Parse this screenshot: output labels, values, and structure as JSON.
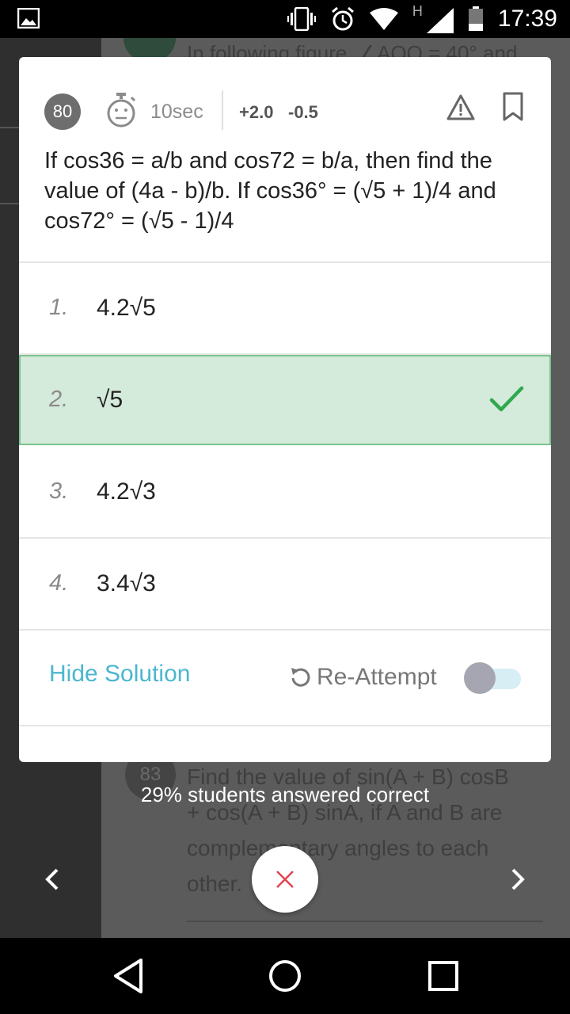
{
  "status_bar": {
    "time": "17:39",
    "network_type": "H",
    "icons": [
      "gallery-icon",
      "vibrate-icon",
      "alarm-icon",
      "wifi-icon",
      "signal-icon",
      "battery-icon"
    ]
  },
  "background": {
    "top_question_partial": "In following figure, ∠AOQ = 40° and",
    "next_question_number": "83",
    "next_question_text": "Find the value of sin(A + B) cosB + cos(A + B) sinA, if A and B are complementary angles to each other."
  },
  "question": {
    "number": "80",
    "timer": "10sec",
    "positive_marks": "+2.0",
    "negative_marks": "-0.5",
    "text": "If cos36 = a/b and cos72 = b/a, then find the value of (4a - b)/b. If cos36° = (√5 + 1)/4 and cos72° = (√5 - 1)/4"
  },
  "options": [
    {
      "num": "1.",
      "text": "4.2√5",
      "state": "normal"
    },
    {
      "num": "2.",
      "text": "√5",
      "state": "correct"
    },
    {
      "num": "3.",
      "text": "4.2√3",
      "state": "normal"
    },
    {
      "num": "4.",
      "text": "3.4√3",
      "state": "normal"
    }
  ],
  "actions": {
    "hide_solution": "Hide Solution",
    "reattempt": "Re-Attempt",
    "reattempt_toggle_on": false
  },
  "toast": "29% students answered correct",
  "colors": {
    "correct_bg": "#d4eadb",
    "correct_border": "#7bc38c",
    "check": "#2fa84f",
    "link": "#4bb7cf",
    "close_x": "#e0454f"
  }
}
